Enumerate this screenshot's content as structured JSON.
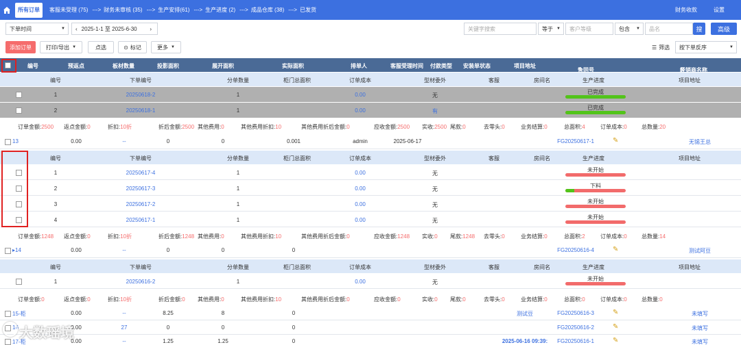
{
  "topbar": {
    "tabs": [
      {
        "label": "所有订单",
        "active": true
      },
      {
        "label": "客服未受理 (75)"
      },
      {
        "label": "财务未审核 (35)"
      },
      {
        "label": "生产安排(61)"
      },
      {
        "label": "生产进度 (2)"
      },
      {
        "label": "成品仓库 (38)"
      },
      {
        "label": "已发货"
      }
    ],
    "arrow": "--->",
    "right": [
      "财务收款",
      "设置"
    ]
  },
  "filter": {
    "time_type": "下单时间",
    "date_range": "2025-1-1 至 2025-6-30",
    "keyword_placeholder": "关键字搜索",
    "op1": "等于",
    "level_placeholder": "客户等级",
    "op2": "包含",
    "product_placeholder": "品名",
    "search": "搜",
    "advanced": "高级"
  },
  "toolbar": {
    "add": "添加订单",
    "print": "打印/导出",
    "pick": "点选",
    "mark": "标记",
    "more": "更多",
    "filter": "筛选",
    "sort": "按下单反序"
  },
  "header": [
    "编号",
    "预返点",
    "板材数量",
    "投影面积",
    "展开面积",
    "实际面积",
    "排单人",
    "客服受理时间",
    "付款类型",
    "安装单状态",
    "项目地址",
    "合同号",
    "经销商名称"
  ],
  "subheader": [
    "编号",
    "下单编号",
    "分单数量",
    "柜门总面积",
    "订单成本",
    "型材委外",
    "客服",
    "房间名",
    "生产进度",
    "项目地址"
  ],
  "group0": {
    "items": [
      {
        "no": "1",
        "order": "20250618-2",
        "qty": "1",
        "cost": "0.00",
        "outsource": "无",
        "status": "已完成",
        "progress": 1.0
      },
      {
        "no": "2",
        "order": "20250618-1",
        "qty": "1",
        "cost": "0.00",
        "outsource": "有",
        "status": "已完成",
        "progress": 1.0
      }
    ],
    "summary": [
      {
        "label": "订单金额:",
        "value": "2500"
      },
      {
        "label": "返点金额:",
        "value": "0"
      },
      {
        "label": "折扣:",
        "value": "10折"
      },
      {
        "label": "折后金额:",
        "value": "2500"
      },
      {
        "label": "其他费用:",
        "value": "0"
      },
      {
        "label": "其他费用折扣:",
        "value": "10"
      },
      {
        "label": "其他费用折后金额:",
        "value": "0"
      },
      {
        "label": "应收金额:",
        "value": "2500"
      },
      {
        "label": "实收:",
        "value": "2500"
      },
      {
        "label": "尾款:",
        "value": "0"
      },
      {
        "label": "去零头:",
        "value": "0"
      },
      {
        "label": "业务结算:",
        "value": "0"
      },
      {
        "label": "总面积:",
        "value": "4"
      },
      {
        "label": "订单成本:",
        "value": "0"
      },
      {
        "label": "总数量:",
        "value": "20"
      }
    ]
  },
  "order13": {
    "id": "13",
    "rebate": "0.00",
    "boards": "--",
    "proj": "0",
    "expand": "0",
    "actual": "0.001",
    "scheduler": "admin",
    "time": "2025-06-17",
    "contract": "FG20250617-1",
    "dealer": "无锡王总"
  },
  "group13": {
    "items": [
      {
        "no": "1",
        "order": "20250617-4",
        "qty": "1",
        "cost": "0.00",
        "outsource": "无",
        "status": "未开始",
        "progress": 0
      },
      {
        "no": "2",
        "order": "20250617-3",
        "qty": "1",
        "cost": "0.00",
        "outsource": "无",
        "status": "下料",
        "progress": 0.15
      },
      {
        "no": "3",
        "order": "20250617-2",
        "qty": "1",
        "cost": "0.00",
        "outsource": "无",
        "status": "未开始",
        "progress": 0
      },
      {
        "no": "4",
        "order": "20250617-1",
        "qty": "1",
        "cost": "0.00",
        "outsource": "无",
        "status": "未开始",
        "progress": 0
      }
    ],
    "summary": [
      {
        "label": "订单金额:",
        "value": "1248"
      },
      {
        "label": "返点金额:",
        "value": "0"
      },
      {
        "label": "折扣:",
        "value": "10折"
      },
      {
        "label": "折后金额:",
        "value": "1248"
      },
      {
        "label": "其他费用:",
        "value": "0"
      },
      {
        "label": "其他费用折扣:",
        "value": "10"
      },
      {
        "label": "其他费用折后金额:",
        "value": "0"
      },
      {
        "label": "应收金额:",
        "value": "1248"
      },
      {
        "label": "实收:",
        "value": "0"
      },
      {
        "label": "尾款:",
        "value": "1248"
      },
      {
        "label": "去零头:",
        "value": "0"
      },
      {
        "label": "业务结算:",
        "value": "0"
      },
      {
        "label": "总面积:",
        "value": "2"
      },
      {
        "label": "订单成本:",
        "value": "0"
      },
      {
        "label": "总数量:",
        "value": "14"
      }
    ]
  },
  "order14": {
    "id": "▸14",
    "rebate": "0.00",
    "boards": "--",
    "proj": "0",
    "expand": "0",
    "actual": "0",
    "contract": "FG20250616-4",
    "dealer": "测试阿豆"
  },
  "group14": {
    "items": [
      {
        "no": "1",
        "order": "20250616-2",
        "qty": "1",
        "cost": "0.00",
        "outsource": "无",
        "status": "未开始",
        "progress": 0
      }
    ],
    "summary": [
      {
        "label": "订单金额:",
        "value": "0"
      },
      {
        "label": "返点金额:",
        "value": "0"
      },
      {
        "label": "折扣:",
        "value": "10折"
      },
      {
        "label": "折后金额:",
        "value": "0"
      },
      {
        "label": "其他费用:",
        "value": "0"
      },
      {
        "label": "其他费用折扣:",
        "value": "10"
      },
      {
        "label": "其他费用折后金额:",
        "value": "0"
      },
      {
        "label": "应收金额:",
        "value": "0"
      },
      {
        "label": "实收:",
        "value": "0"
      },
      {
        "label": "尾款:",
        "value": "0"
      },
      {
        "label": "去零头:",
        "value": "0"
      },
      {
        "label": "业务结算:",
        "value": "0"
      },
      {
        "label": "总面积:",
        "value": "0"
      },
      {
        "label": "订单成本:",
        "value": "0"
      },
      {
        "label": "总数量:",
        "value": "0"
      }
    ]
  },
  "order15": {
    "id": "15-柜",
    "rebate": "0.00",
    "boards": "--",
    "proj": "8.25",
    "expand": "8",
    "actual": "0",
    "scheduler": "测试豆",
    "contract": "FG20250616-3",
    "dealer": "未填写"
  },
  "order16": {
    "id": "16",
    "rebate": "0.00",
    "boards": "27",
    "proj": "0",
    "expand": "0",
    "actual": "0",
    "contract": "FG20250616-2",
    "dealer": "未填写"
  },
  "order17": {
    "id": "17-柜",
    "rebate": "0.00",
    "boards": "--",
    "proj": "1.25",
    "expand": "1.25",
    "actual": "0",
    "time": "2025-06-16 09:39:",
    "contract": "FG20250616-1",
    "dealer": "未填写"
  },
  "watermark": "大数瑶境"
}
